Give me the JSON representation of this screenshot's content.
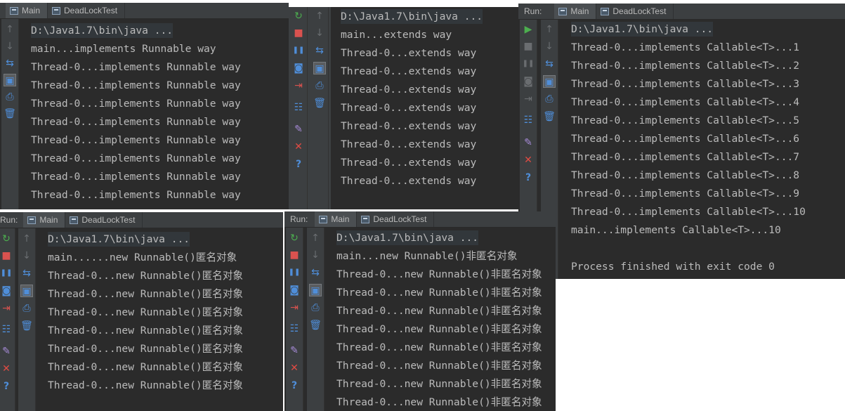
{
  "panel_tl": {
    "tabs": [
      "Main",
      "DeadLockTest"
    ],
    "lines": [
      "D:\\Java1.7\\bin\\java ...",
      "main...implements Runnable way",
      "Thread-0...implements Runnable way",
      "Thread-0...implements Runnable way",
      "Thread-0...implements Runnable way",
      "Thread-0...implements Runnable way",
      "Thread-0...implements Runnable way",
      "Thread-0...implements Runnable way",
      "Thread-0...implements Runnable way",
      "Thread-0...implements Runnable way"
    ]
  },
  "panel_tm": {
    "lines": [
      "D:\\Java1.7\\bin\\java ...",
      "main...extends way",
      "Thread-0...extends way",
      "Thread-0...extends way",
      "Thread-0...extends way",
      "Thread-0...extends way",
      "Thread-0...extends way",
      "Thread-0...extends way",
      "Thread-0...extends way",
      "Thread-0...extends way"
    ]
  },
  "panel_tr": {
    "run_label": "Run:",
    "tabs": [
      "Main",
      "DeadLockTest"
    ],
    "lines": [
      "D:\\Java1.7\\bin\\java ...",
      "Thread-0...implements Callable<T>...1",
      "Thread-0...implements Callable<T>...2",
      "Thread-0...implements Callable<T>...3",
      "Thread-0...implements Callable<T>...4",
      "Thread-0...implements Callable<T>...5",
      "Thread-0...implements Callable<T>...6",
      "Thread-0...implements Callable<T>...7",
      "Thread-0...implements Callable<T>...8",
      "Thread-0...implements Callable<T>...9",
      "Thread-0...implements Callable<T>...10",
      "main...implements Callable<T>...10",
      "",
      "Process finished with exit code 0"
    ]
  },
  "panel_bl": {
    "run_label": "Run:",
    "tabs": [
      "Main",
      "DeadLockTest"
    ],
    "lines": [
      "D:\\Java1.7\\bin\\java ...",
      "main......new Runnable()匿名对象",
      "Thread-0...new Runnable()匿名对象",
      "Thread-0...new Runnable()匿名对象",
      "Thread-0...new Runnable()匿名对象",
      "Thread-0...new Runnable()匿名对象",
      "Thread-0...new Runnable()匿名对象",
      "Thread-0...new Runnable()匿名对象",
      "Thread-0...new Runnable()匿名对象"
    ]
  },
  "panel_bm": {
    "run_label": "Run:",
    "tabs": [
      "Main",
      "DeadLockTest"
    ],
    "lines": [
      "D:\\Java1.7\\bin\\java ...",
      "main...new Runnable()非匿名对象",
      "Thread-0...new Runnable()非匿名对象",
      "Thread-0...new Runnable()非匿名对象",
      "Thread-0...new Runnable()非匿名对象",
      "Thread-0...new Runnable()非匿名对象",
      "Thread-0...new Runnable()非匿名对象",
      "Thread-0...new Runnable()非匿名对象",
      "Thread-0...new Runnable()非匿名对象",
      "Thread-0...new Runnable()非匿名对象"
    ]
  },
  "icons": {
    "rerun": "↻",
    "run": "▶",
    "stop": "■",
    "pause": "❚❚",
    "up": "↑",
    "down": "↓",
    "camera": "◙",
    "exit": "⇥",
    "wrap": "⇆",
    "scroll": "▣",
    "print": "⎙",
    "trash": "🗑",
    "layout": "☷",
    "pin": "✎",
    "close": "✕",
    "help": "?"
  }
}
